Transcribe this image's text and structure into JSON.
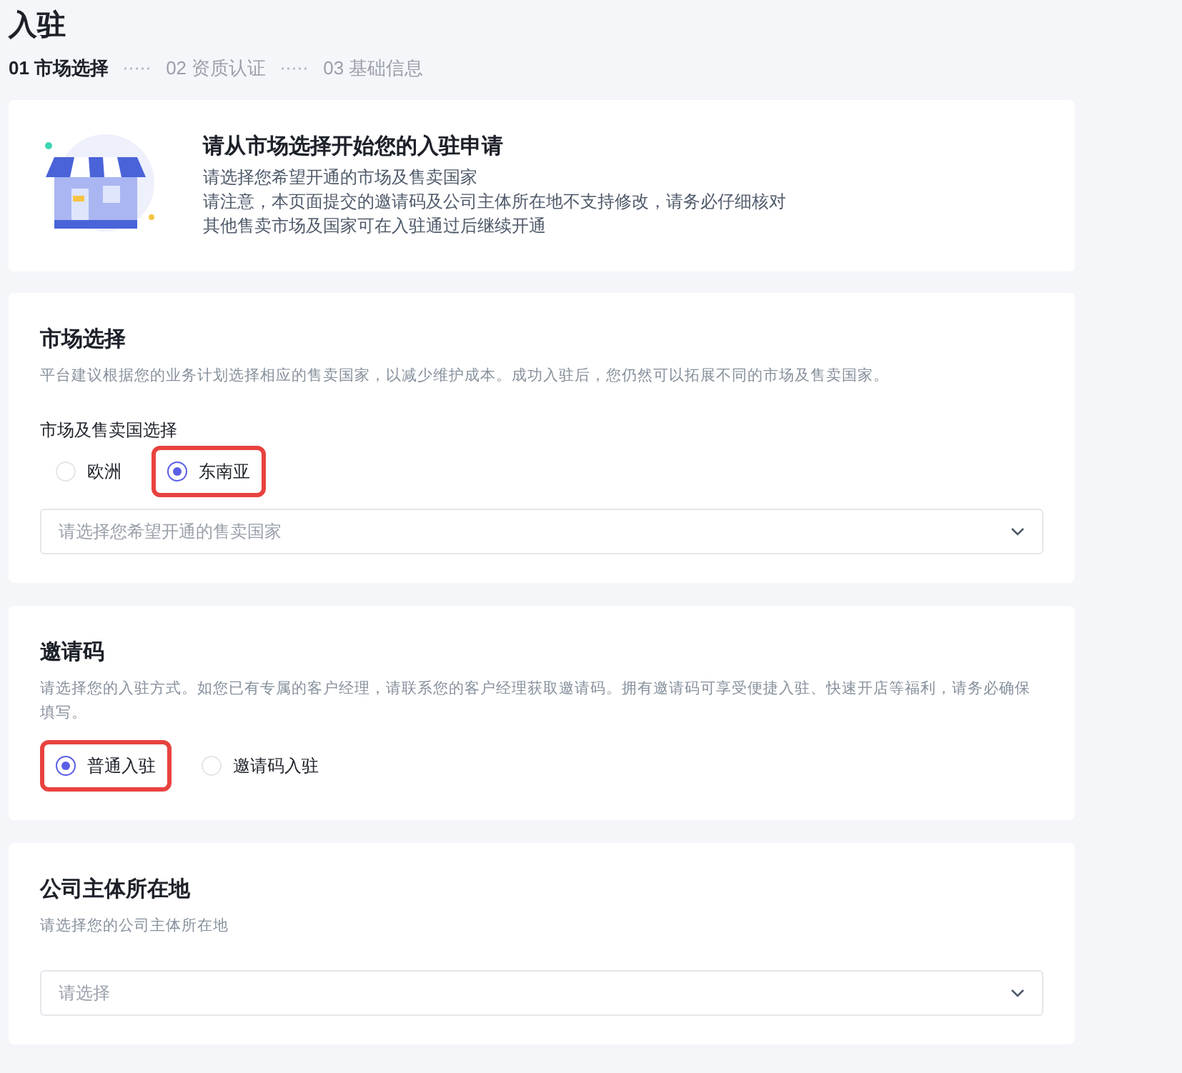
{
  "page_title": "入驻",
  "steps": [
    {
      "label": "01 市场选择",
      "selected": true
    },
    {
      "label": "02 资质认证",
      "selected": false
    },
    {
      "label": "03 基础信息",
      "selected": false
    }
  ],
  "intro": {
    "title": "请从市场选择开始您的入驻申请",
    "lines": [
      "请选择您希望开通的市场及售卖国家",
      "请注意，本页面提交的邀请码及公司主体所在地不支持修改，请务必仔细核对",
      "其他售卖市场及国家可在入驻通过后继续开通"
    ]
  },
  "sections": [
    {
      "title": "市场选择",
      "description": "平台建议根据您的业务计划选择相应的售卖国家，以减少维护成本。成功入驻后，您仍然可以拓展不同的市场及售卖国家。",
      "field_label": "市场及售卖国选择",
      "options": [
        {
          "label": "欧洲",
          "selected": false,
          "highlighted": false
        },
        {
          "label": "东南亚",
          "selected": true,
          "highlighted": true
        }
      ],
      "select": {
        "placeholder": "请选择您希望开通的售卖国家"
      }
    },
    {
      "title": "邀请码",
      "description": "请选择您的入驻方式。如您已有专属的客户经理，请联系您的客户经理获取邀请码。拥有邀请码可享受便捷入驻、快速开店等福利，请务必确保填写。",
      "options": [
        {
          "label": "普通入驻",
          "selected": true,
          "highlighted": true
        },
        {
          "label": "邀请码入驻",
          "selected": false,
          "highlighted": false
        }
      ]
    },
    {
      "title": "公司主体所在地",
      "description": "请选择您的公司主体所在地",
      "select": {
        "placeholder": "请选择"
      }
    }
  ]
}
